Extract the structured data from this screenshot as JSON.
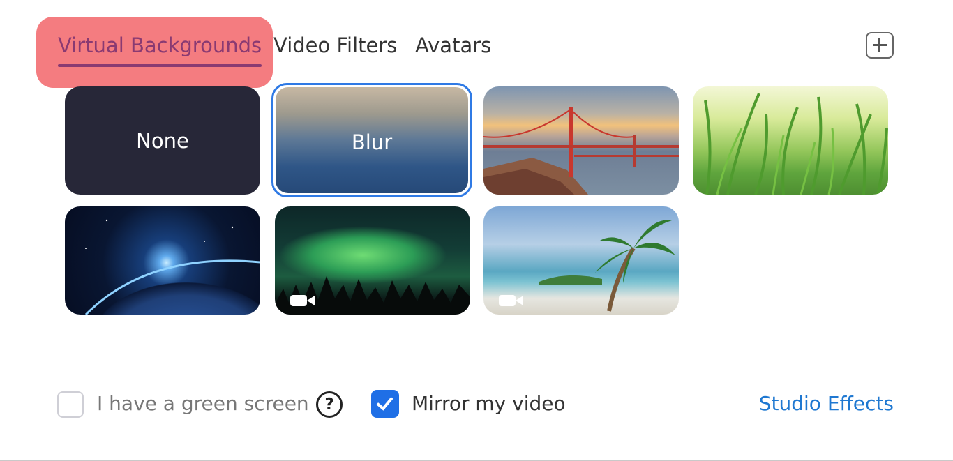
{
  "tabs": [
    {
      "label": "Virtual Backgrounds",
      "active": true
    },
    {
      "label": "Video Filters"
    },
    {
      "label": "Avatars"
    }
  ],
  "add_button": {
    "icon": "plus-icon"
  },
  "backgrounds": [
    {
      "label": "None"
    },
    {
      "label": "Blur",
      "selected": true
    },
    {
      "name": "golden-gate-bridge"
    },
    {
      "name": "grass"
    },
    {
      "name": "earth-from-space"
    },
    {
      "name": "aurora",
      "video": true
    },
    {
      "name": "beach",
      "video": true
    }
  ],
  "controls": {
    "green_screen_label": "I have a green screen",
    "green_screen_checked": false,
    "help_icon": "?",
    "mirror_label": "Mirror my video",
    "mirror_checked": true,
    "studio_effects": "Studio Effects"
  },
  "colors": {
    "accent": "#1f6fe6",
    "link": "#1f78d1",
    "highlight": "#f47c80",
    "active_tab": "#8a3a72"
  }
}
